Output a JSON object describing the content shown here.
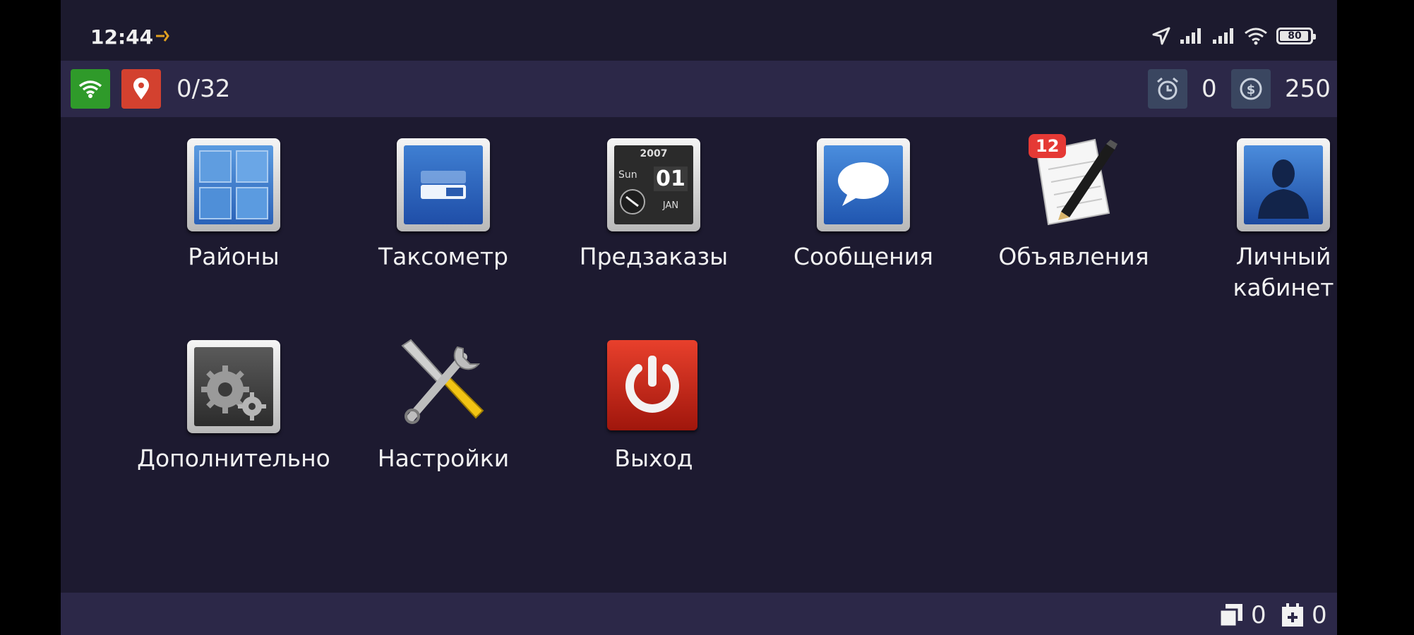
{
  "statusbar": {
    "time": "12:44",
    "battery": "80",
    "icons": [
      "navigation-arrow-icon",
      "signal-icon",
      "signal-icon",
      "wifi-icon",
      "battery-icon"
    ]
  },
  "header": {
    "counter": "0/32",
    "alarm_count": "0",
    "balance": "250",
    "icons": [
      "wifi-icon",
      "location-pin-icon",
      "alarm-clock-icon",
      "dollar-coin-icon"
    ],
    "colors": {
      "wifi": "#2f9a2a",
      "pin": "#d3412f",
      "pill": "#3a4660"
    }
  },
  "menu": {
    "items": [
      {
        "label": "Районы",
        "icon": "districts-grid-icon"
      },
      {
        "label": "Таксометр",
        "icon": "taximeter-icon"
      },
      {
        "label": "Предзаказы",
        "icon": "calendar-clock-icon",
        "calendar": {
          "year": "2007",
          "weekday": "Sun",
          "day": "01",
          "month": "JAN"
        }
      },
      {
        "label": "Сообщения",
        "icon": "speech-bubble-icon"
      },
      {
        "label": "Объявления",
        "icon": "notepad-pencil-icon",
        "badge": "12"
      },
      {
        "label_line1": "Личный",
        "label_line2": "кабинет",
        "icon": "user-silhouette-icon"
      },
      {
        "label": "Дополнительно",
        "icon": "gears-icon"
      },
      {
        "label": "Настройки",
        "icon": "wrench-screwdriver-icon"
      },
      {
        "label": "Выход",
        "icon": "power-icon"
      }
    ]
  },
  "footer": {
    "copies_count": "0",
    "calendar_count": "0"
  }
}
